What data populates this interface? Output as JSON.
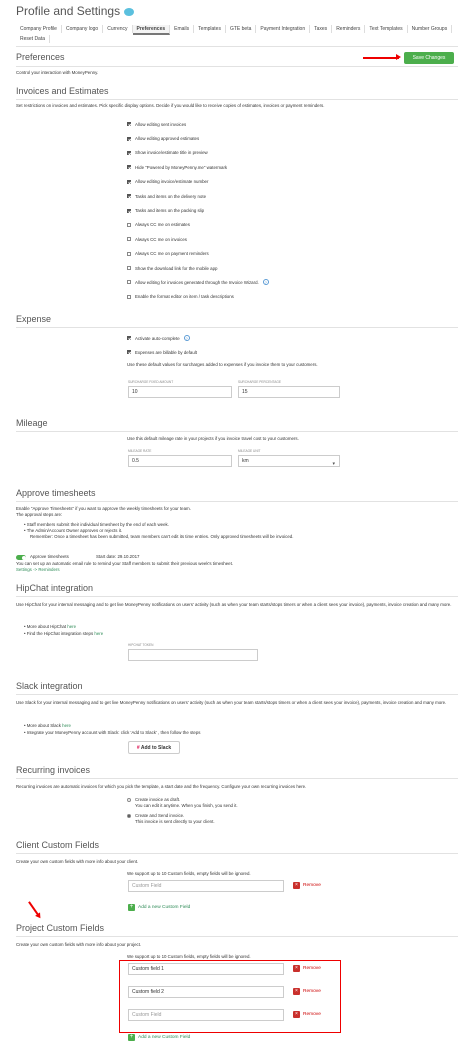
{
  "header": {
    "title": "Profile and Settings",
    "save_label": "Save Changes"
  },
  "tabs": [
    "Company Profile",
    "Company logo",
    "Currency",
    "Preferences",
    "Emails",
    "Templates",
    "GTE beta",
    "Payment Integration",
    "Taxes",
    "Reminders",
    "Text Templates",
    "Number Groups",
    "Reset Data"
  ],
  "preferences": {
    "title": "Preferences",
    "desc": "Control your interaction with MoneyPenny."
  },
  "invoices": {
    "title": "Invoices and Estimates",
    "desc": "Set restrictions on invoices and estimates. Pick specific display options. Decide if you would like to receive copies of estimates, invoices or payment reminders.",
    "options": [
      {
        "label": "Allow editing sent invoices",
        "checked": true
      },
      {
        "label": "Allow editing approved estimates",
        "checked": true
      },
      {
        "label": "Show invoice/estimate title in preview",
        "checked": true
      },
      {
        "label": "Hide \"Powered by MoneyPenny.me\" watermark",
        "checked": true
      },
      {
        "label": "Allow editing invoice/estimate number",
        "checked": true
      },
      {
        "label": "Tasks and items on the delivery note",
        "checked": true
      },
      {
        "label": "Tasks and items on the packing slip",
        "checked": true
      },
      {
        "label": "Always CC me on estimates",
        "checked": false
      },
      {
        "label": "Always CC me on invoices",
        "checked": false
      },
      {
        "label": "Always CC me on payment reminders",
        "checked": false
      },
      {
        "label": "Show the download link for the mobile app",
        "checked": false
      },
      {
        "label": "Allow editing for invoices generated through the Invoice Wizard.",
        "checked": false
      },
      {
        "label": "Enable the format editor on item / task descriptions",
        "checked": false
      }
    ]
  },
  "expense": {
    "title": "Expense",
    "opt1": "Activate auto-complete",
    "opt2": "Expenses are billable by default",
    "desc": "Use these default values for surcharges added to expenses if you invoice them to your customers.",
    "label_amount": "SURCHARGE FIXED AMOUNT",
    "value_amount": "10",
    "label_pct": "SURCHARGE PERCENTAGE",
    "value_pct": "15"
  },
  "mileage": {
    "title": "Mileage",
    "desc": "Use this default mileage rate in your projects if you invoice travel cost to your customers.",
    "label_rate": "MILEAGE RATE",
    "value_rate": "0.5",
    "label_unit": "MILEAGE UNIT",
    "value_unit": "km"
  },
  "timesheets": {
    "title": "Approve timesheets",
    "line1": "Enable \"Approve Timesheets\" if you want to approve the weekly timesheets for your team.",
    "line2": "The approval steps are:",
    "b1": "Staff members submit their individual timesheet by the end of each week.",
    "b2": "The Admin/Account Owner approves or rejects it.",
    "line3": "Remember: Once a timesheet has been submitted, team members can't edit its time entries. Only approved timesheets will be invoiced.",
    "toggle_label": "Approve timesheets",
    "start": "Start date: 29.10.2017",
    "line4": "You can set up an automatic email rule to remind your Staff members to submit their previous week's timesheet.",
    "settings_link": "Settings -> Reminders"
  },
  "hipchat": {
    "title": "HipChat integration",
    "desc": "Use HipChat for your internal messaging and to get live MoneyPenny notifications on users' activity (such as when your team starts/stops timers or when a client sees your invoice), payments, invoice creation and many more.",
    "b1": "More about HipChat",
    "b2": "Find the HipChat integration steps",
    "here": "here",
    "token_label": "HIPCHAT TOKEN"
  },
  "slack": {
    "title": "Slack integration",
    "desc": "Use Slack for your internal messaging and to get live MoneyPenny notifications on users' activity (such as when your team starts/stops timers or when a client sees your invoice), payments, invoice creation and many more.",
    "b1": "More about Slack",
    "here": "here",
    "b2": "Integrate your MoneyPenny account with Slack: click 'Add to Slack' , then follow the steps",
    "button": "Add to Slack"
  },
  "recurring": {
    "title": "Recurring invoices",
    "desc": "Recurring invoices are automatic invoices for which you pick the template, a start date and the frequency. Configure your own recurring invoices here.",
    "r1": "Create invoice as draft.",
    "r1b": "You can edit it anytime. When you finish, you send it.",
    "r2": "Create and Send invoice.",
    "r2b": "This invoice is sent directly to your client."
  },
  "client_fields": {
    "title": "Client Custom Fields",
    "desc": "Create your own custom fields with more info about your client.",
    "note": "We support up to 10 Custom fields, empty fields will be ignored.",
    "placeholder": "Custom Field",
    "remove": "Remove",
    "add": "Add a new Custom Field"
  },
  "project_fields": {
    "title": "Project Custom Fields",
    "desc": "Create your own custom fields with more info about your project.",
    "note": "We support up to 10 Custom fields, empty fields will be ignored.",
    "fields": [
      "Custom field 1",
      "Custom field 2"
    ],
    "placeholder": "Custom Field",
    "remove": "Remove",
    "add": "Add a new Custom Field"
  }
}
